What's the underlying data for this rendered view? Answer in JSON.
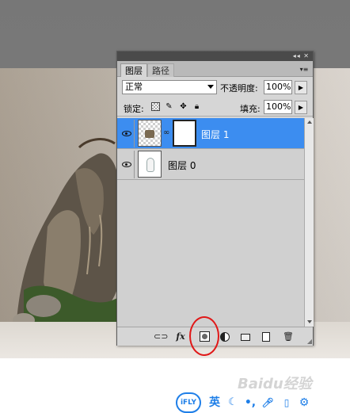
{
  "panel": {
    "tabs": [
      "图层",
      "路径"
    ],
    "menu_button": "▾≡",
    "titlebar_buttons": "◂◂ ✕"
  },
  "blend": {
    "mode": "正常",
    "opacity_label": "不透明度:",
    "opacity_value": "100%"
  },
  "lock": {
    "label": "锁定:",
    "fill_label": "填充:",
    "fill_value": "100%"
  },
  "layers": [
    {
      "name": "图层 1",
      "selected": true,
      "visible": true,
      "has_mask": true
    },
    {
      "name": "图层 0",
      "selected": false,
      "visible": true,
      "has_mask": false
    }
  ],
  "footer_icons": [
    "link-layers",
    "fx",
    "add-layer-mask",
    "adjustment-layer",
    "group",
    "new-layer",
    "delete"
  ],
  "footer": {
    "fx_label": "fx"
  },
  "ime": {
    "logo": "iFLY",
    "lang": "英"
  },
  "watermark": "Baidu经验",
  "colors": {
    "selection": "#3c8df0",
    "highlight": "#e01818",
    "ime": "#1f7fe8"
  }
}
